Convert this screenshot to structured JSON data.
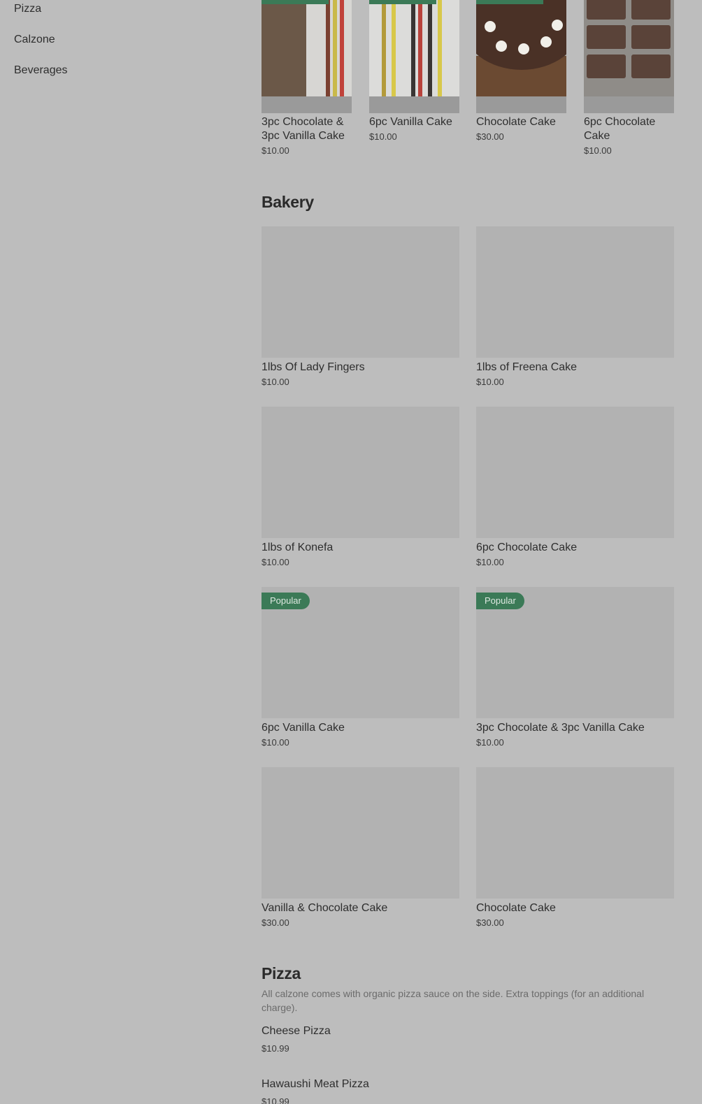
{
  "sidebar": {
    "items": [
      {
        "label": "Pizza"
      },
      {
        "label": "Calzone"
      },
      {
        "label": "Beverages"
      }
    ]
  },
  "top_row": [
    {
      "name": "3pc Chocolate & 3pc Vanilla Cake",
      "price": "$10.00"
    },
    {
      "name": "6pc Vanilla Cake",
      "price": "$10.00"
    },
    {
      "name": "Chocolate Cake",
      "price": "$30.00"
    },
    {
      "name": "6pc Chocolate Cake",
      "price": "$10.00"
    }
  ],
  "bakery": {
    "title": "Bakery",
    "items": [
      {
        "name": "1lbs Of Lady Fingers",
        "price": "$10.00"
      },
      {
        "name": "1lbs of Freena Cake",
        "price": "$10.00"
      },
      {
        "name": "1lbs of Konefa",
        "price": "$10.00"
      },
      {
        "name": "6pc Chocolate Cake",
        "price": "$10.00"
      },
      {
        "name": "6pc Vanilla Cake",
        "price": "$10.00",
        "badge": "Popular"
      },
      {
        "name": "3pc Chocolate & 3pc Vanilla Cake",
        "price": "$10.00",
        "badge": "Popular"
      },
      {
        "name": "Vanilla & Chocolate Cake",
        "price": "$30.00"
      },
      {
        "name": "Chocolate Cake",
        "price": "$30.00"
      }
    ]
  },
  "pizza": {
    "title": "Pizza",
    "description": "All calzone comes with organic pizza sauce on the side. Extra toppings (for an additional charge).",
    "items": [
      {
        "name": "Cheese Pizza",
        "price": "$10.99"
      },
      {
        "name": "Hawaushi Meat Pizza",
        "price": "$10.99"
      }
    ]
  },
  "colors": {
    "background": "#bdbdbd",
    "badge": "#3b7a57",
    "placeholder": "#b2b2b2"
  }
}
